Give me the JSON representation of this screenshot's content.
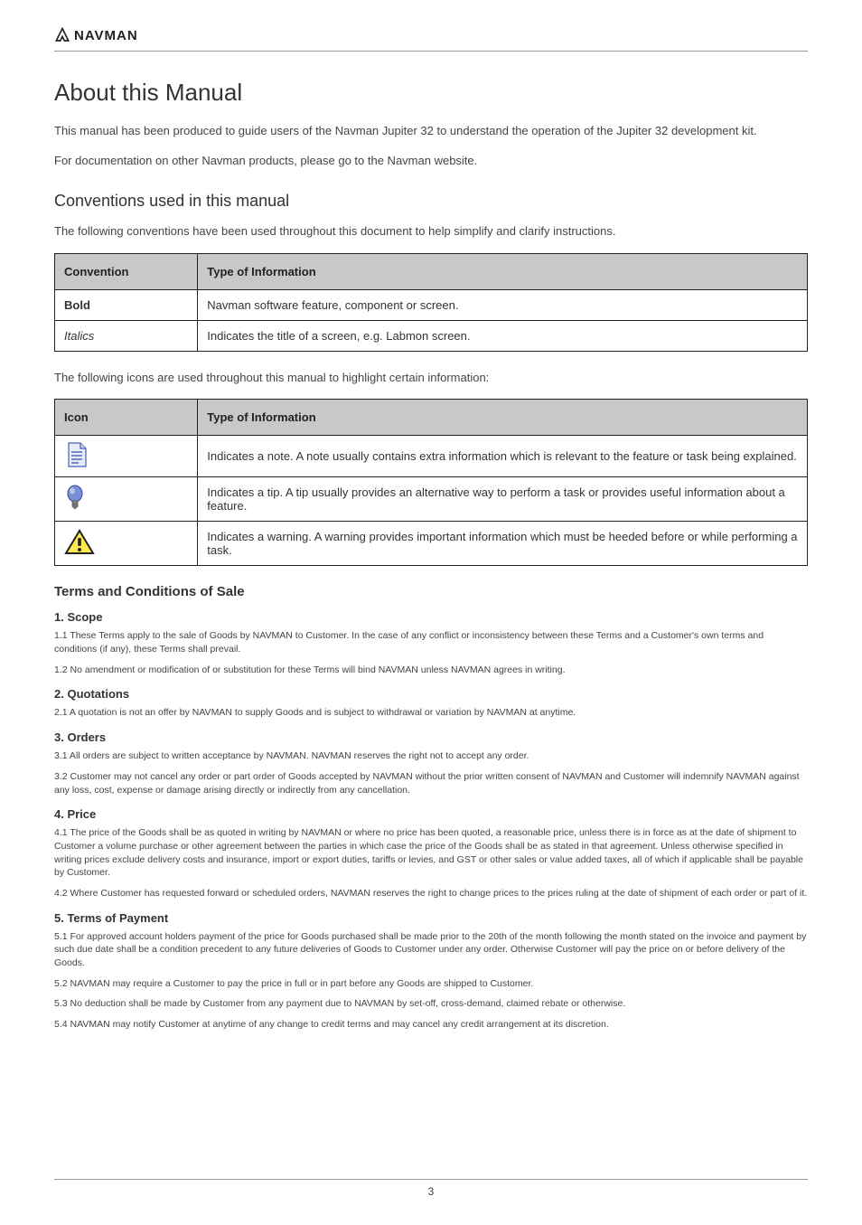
{
  "header": {
    "brand": "NAVMAN"
  },
  "intro": {
    "title": "About this Manual",
    "p1": "This manual has been produced to guide users of the Navman Jupiter 32 to understand the operation of the Jupiter 32 development kit.",
    "p2": "For documentation on other Navman products, please go to the Navman website."
  },
  "conventions": {
    "title": "Conventions used in this manual",
    "note": "The following conventions have been used throughout this document to help simplify and clarify instructions.",
    "table1_header_col1": "Convention",
    "table1_header_col2": "Type of Information",
    "table1_row1_col1": "Bold",
    "table1_row1_col2": "Navman software feature, component or screen.",
    "table1_row2_col1": "Italics",
    "table1_row2_col2": "Indicates the title of a screen, e.g. Labmon screen.",
    "icons_note": "The following icons are used throughout this manual to highlight certain information:",
    "table2_header_col1": "Icon",
    "table2_header_col2": "Type of Information",
    "table2_row1": "Indicates a note. A note usually contains extra information which is relevant to the feature or task being explained.",
    "table2_row2": "Indicates a tip. A tip usually provides an alternative way to perform a task or provides useful information about a feature.",
    "table2_row3": "Indicates a warning. A warning provides important information which must be heeded before or while performing a task."
  },
  "terms": {
    "title": "Terms and Conditions of Sale",
    "h1": "1. Scope",
    "p1": "1.1 These Terms apply to the sale of Goods by NAVMAN to Customer. In the case of any conflict or inconsistency between these Terms and a Customer's own terms and conditions (if any), these Terms shall prevail.",
    "p2": "1.2 No amendment or modification of or substitution for these Terms will bind NAVMAN unless NAVMAN agrees in writing.",
    "h2": "2. Quotations",
    "p3": "2.1 A quotation is not an offer by NAVMAN to supply Goods and is subject to withdrawal or variation by NAVMAN at anytime.",
    "h3": "3. Orders",
    "p4": "3.1 All orders are subject to written acceptance by NAVMAN. NAVMAN reserves the right not to accept any order.",
    "p5": "3.2 Customer may not cancel any order or part order of Goods accepted by NAVMAN without the prior written consent of NAVMAN and Customer will indemnify NAVMAN against any loss, cost, expense or damage arising directly or indirectly from any cancellation.",
    "h4": "4. Price",
    "p6": "4.1 The price of the Goods shall be as quoted in writing by NAVMAN or where no price has been quoted, a reasonable price, unless there is in force as at the date of shipment to Customer a volume purchase or other agreement between the parties in which case the price of the Goods shall be as stated in that agreement. Unless otherwise specified in writing prices exclude delivery costs and insurance, import or export duties, tariffs or levies, and GST or other sales or value added taxes, all of which if applicable shall be payable by Customer.",
    "p7": "4.2 Where Customer has requested forward or scheduled orders, NAVMAN reserves the right to change prices to the prices ruling at the date of shipment of each order or part of it.",
    "h5": "5. Terms of Payment",
    "p8": "5.1 For approved account holders payment of the price for Goods purchased shall be made prior to the 20th of the month following the month stated on the invoice and payment by such due date shall be a condition precedent to any future deliveries of Goods to Customer under any order. Otherwise Customer will pay the price on or before delivery of the Goods.",
    "p9": "5.2 NAVMAN may require a Customer to pay the price in full or in part before any Goods are shipped to Customer.",
    "p10": "5.3 No deduction shall be made by Customer from any payment due to NAVMAN by set-off, cross-demand, claimed rebate or otherwise.",
    "p11": "5.4 NAVMAN may notify Customer at anytime of any change to credit terms and may cancel any credit arrangement at its discretion."
  },
  "footer": {
    "page_number": "3"
  }
}
